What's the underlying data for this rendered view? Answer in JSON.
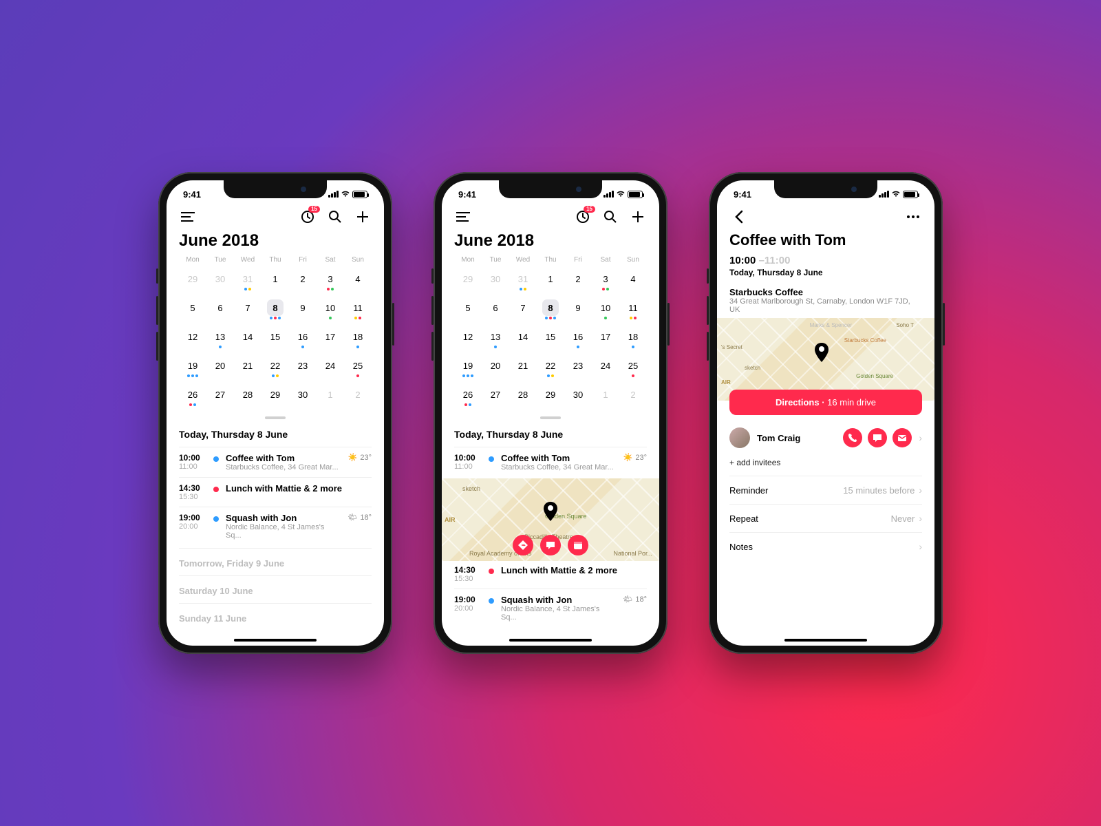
{
  "status_time": "9:41",
  "badge_count": "15",
  "month_title": "June 2018",
  "weekdays": [
    "Mon",
    "Tue",
    "Wed",
    "Thu",
    "Fri",
    "Sat",
    "Sun"
  ],
  "calendar": [
    {
      "n": "29",
      "dim": true
    },
    {
      "n": "30",
      "dim": true
    },
    {
      "n": "31",
      "dim": true,
      "dots": [
        "b",
        "o"
      ]
    },
    {
      "n": "1"
    },
    {
      "n": "2"
    },
    {
      "n": "3",
      "dots": [
        "r",
        "g"
      ]
    },
    {
      "n": "4"
    },
    {
      "n": "5"
    },
    {
      "n": "6"
    },
    {
      "n": "7"
    },
    {
      "n": "8",
      "sel": true,
      "dots": [
        "b",
        "r",
        "b"
      ]
    },
    {
      "n": "9"
    },
    {
      "n": "10",
      "dots": [
        "g"
      ]
    },
    {
      "n": "11",
      "dots": [
        "o",
        "r"
      ]
    },
    {
      "n": "12"
    },
    {
      "n": "13",
      "dots": [
        "b"
      ]
    },
    {
      "n": "14"
    },
    {
      "n": "15"
    },
    {
      "n": "16",
      "dots": [
        "b"
      ]
    },
    {
      "n": "17"
    },
    {
      "n": "18",
      "dots": [
        "b"
      ]
    },
    {
      "n": "19",
      "dots": [
        "b",
        "b",
        "b"
      ]
    },
    {
      "n": "20"
    },
    {
      "n": "21"
    },
    {
      "n": "22",
      "dots": [
        "b",
        "o"
      ]
    },
    {
      "n": "23"
    },
    {
      "n": "24"
    },
    {
      "n": "25",
      "dots": [
        "r"
      ]
    },
    {
      "n": "26",
      "dots": [
        "r",
        "b"
      ]
    },
    {
      "n": "27"
    },
    {
      "n": "28"
    },
    {
      "n": "29"
    },
    {
      "n": "30"
    },
    {
      "n": "1",
      "dim": true
    },
    {
      "n": "2",
      "dim": true
    }
  ],
  "today_label": "Today, Thursday 8 June",
  "events": [
    {
      "start": "10:00",
      "end": "11:00",
      "color": "b",
      "name": "Coffee with Tom",
      "loc": "Starbucks Coffee, 34 Great Mar...",
      "weather": "☀️",
      "temp": "23°"
    },
    {
      "start": "14:30",
      "end": "15:30",
      "color": "r",
      "name": "Lunch with Mattie & 2 more",
      "loc": "",
      "weather": "",
      "temp": ""
    },
    {
      "start": "19:00",
      "end": "20:00",
      "color": "b",
      "name": "Squash with Jon",
      "loc": "Nordic Balance, 4 St James's Sq...",
      "weather": "🌤",
      "temp": "18°"
    }
  ],
  "future_days": [
    "Tomorrow, Friday 9 June",
    "Saturday 10 June",
    "Sunday 11 June"
  ],
  "map_labels": {
    "sketch": "sketch",
    "golden": "Golden Square",
    "picc": "Piccadilly Theatre",
    "royal": "Royal Academy of Arts",
    "natpor": "National Por...",
    "air": "AIR"
  },
  "detail": {
    "title": "Coffee with Tom",
    "time_start": "10:00",
    "time_end": "–11:00",
    "date": "Today, Thursday 8 June",
    "loc_name": "Starbucks Coffee",
    "loc_addr": "34 Great Marlborough St, Carnaby, London W1F 7JD, UK",
    "map_labels": {
      "soho": "Soho T",
      "starb": "Starbucks Coffee",
      "secret": "'s Secret",
      "sketch": "sketch",
      "golden": "Golden Square",
      "ms": "Marks & Spencer",
      "air": "AIR"
    },
    "directions_label": "Directions",
    "directions_time": "16 min drive",
    "person": "Tom Craig",
    "add_invitees": "+ add invitees",
    "rows": {
      "reminder_k": "Reminder",
      "reminder_v": "15 minutes before",
      "repeat_k": "Repeat",
      "repeat_v": "Never",
      "notes_k": "Notes"
    }
  }
}
